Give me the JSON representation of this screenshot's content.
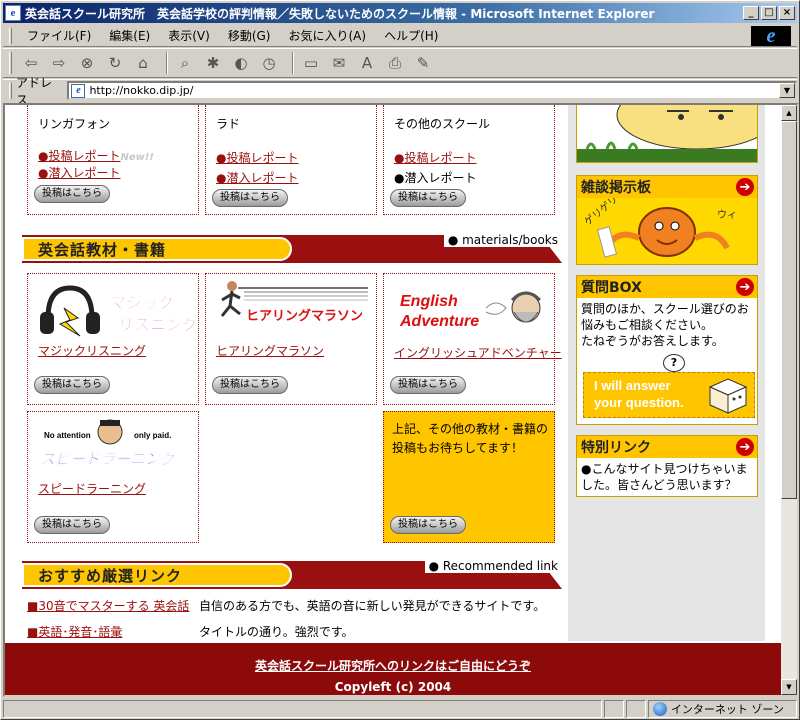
{
  "window": {
    "title": "英会話スクール研究所　英会話学校の評判情報／失敗しないためのスクール情報 - Microsoft Internet Explorer",
    "buttons": [
      "_",
      "□",
      "×"
    ]
  },
  "menu": [
    "ファイル(F)",
    "編集(E)",
    "表示(V)",
    "移動(G)",
    "お気に入り(A)",
    "ヘルプ(H)"
  ],
  "address": {
    "label": "アドレス",
    "url": "http://nokko.dip.jp/"
  },
  "schools": [
    {
      "name": "リンガフォン",
      "line1": "●投稿レポート",
      "line1_new": "New!!",
      "line2": "●潜入レポート",
      "button": "投稿はこちら"
    },
    {
      "name": "ラド",
      "line1": "●投稿レポート",
      "line2": "●潜入レポート",
      "button": "投稿はこちら"
    },
    {
      "name": "その他のスクール",
      "line1": "●投稿レポート",
      "line2": "●潜入レポート",
      "button": "投稿はこちら"
    }
  ],
  "section_materials": {
    "title": "英会話教材・書籍",
    "right": "● materials/books"
  },
  "materials": [
    {
      "logo_text": "マジック\nリスニング",
      "link": "マジックリスニング",
      "button": "投稿はこちら"
    },
    {
      "logo_text": "ヒアリングマラソン",
      "link": "ヒアリングマラソン",
      "button": "投稿はこちら"
    },
    {
      "logo_text": "English\nAdventure",
      "link": "イングリッシュアドベンチャー",
      "button": "投稿はこちら"
    },
    {
      "logo_text": "スピードラーニング",
      "logo_small": "No attention",
      "logo_small2": "only paid.",
      "link": "スピードラーニング",
      "button": "投稿はこちら"
    }
  ],
  "other_materials": {
    "text": "上記、その他の教材・書籍の投稿もお待ちしてます！",
    "button": "投稿はこちら"
  },
  "section_links": {
    "title": "おすすめ厳選リンク",
    "right": "● Recommended link"
  },
  "recommended": [
    {
      "link": "■30音でマスターする 英会話",
      "desc": "自信のある方でも、英語の音に新しい発見ができるサイトです。"
    },
    {
      "link": "■英語･発音･語彙",
      "desc": "タイトルの通り。強烈です。"
    }
  ],
  "sidebar": {
    "bbs": {
      "title": "雑談掲示板",
      "caption1": "ゲリゲリ",
      "caption2": "ウィ"
    },
    "qa": {
      "title": "質問BOX",
      "text": "質問のほか、スクール選びのお悩みもご相談ください。\nたねぞうがお答えします。",
      "banner": "I will answer\nyour question."
    },
    "special": {
      "title": "特別リンク",
      "text": "●こんなサイト見つけちゃいました。皆さんどう思います？"
    }
  },
  "footer": {
    "link": "英会話スクール研究所へのリンクはご自由にどうぞ",
    "copy": "Copyleft (c) 2004"
  },
  "status": {
    "zone": "インターネット ゾーン"
  },
  "colors": {
    "accent_red": "#9a1010",
    "accent_yellow": "#ffc600",
    "footer": "#8c0a0a"
  }
}
